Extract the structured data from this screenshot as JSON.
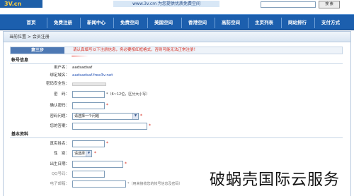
{
  "banner": {
    "logo": "3V.cn",
    "slogan": "www.3v.cm 为您提供优质免费空间",
    "search_value": "",
    "search_button": "搜 索"
  },
  "nav": [
    "首页",
    "免费注册",
    "新闻中心",
    "免费空间",
    "美国空间",
    "香港空间",
    "高防空间",
    "主页列表",
    "网站排行",
    "支付方式"
  ],
  "breadcrumb": "当前位置 > 会员注册",
  "step": {
    "label": "第三步",
    "note": "请认真填写以下注册信息，务必要按红框格式，否则可能无法正常注册！"
  },
  "account_section": {
    "title": "帐号信息",
    "username_label": "用户名：",
    "username_value": "aadsadsaf",
    "domain_label": "绑定域名：",
    "domain_value": "aadsadsaf.free3v.net",
    "security_label": "密码安全性：",
    "password_label": "密　码：",
    "password_hint": "*（6~12位，区分大小写）",
    "confirm_label": "确认密码：",
    "question_label": "密码问题：",
    "question_value": "请选择一个问题",
    "answer_label": "您的答案："
  },
  "basic_section": {
    "title": "基本资料",
    "realname_label": "真实姓名：",
    "gender_label": "性　别：",
    "gender_value": "请选择",
    "birthday_label": "出生日期：",
    "qq_label": "QQ号码：",
    "email_label": "电子邮箱：",
    "email_hint": "*（用来接收您的帐号信息及密码）"
  },
  "watermark": "破蜗壳国际云服务"
}
